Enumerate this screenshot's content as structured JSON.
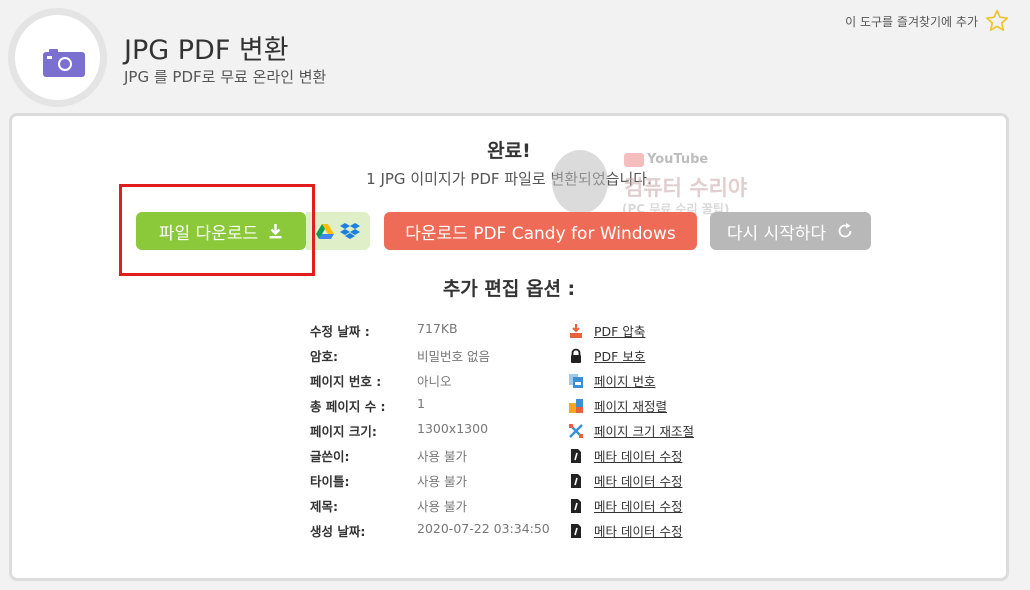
{
  "header": {
    "title": "JPG PDF 변환",
    "subtitle": "JPG 를 PDF로 무료 온라인 변환",
    "favorite_label": "이 도구를 즐겨찾기에 추가",
    "logo_icon": "camera-icon",
    "favorite_icon": "star-outline-icon"
  },
  "result": {
    "title": "완료!",
    "message": "1 JPG 이미지가 PDF 파일로 변환되었습니다."
  },
  "buttons": {
    "download_label": "파일 다운로드",
    "candy_label": "다운로드 PDF Candy for Windows",
    "restart_label": "다시 시작하다"
  },
  "watermark": {
    "badge": "YouTube",
    "main": "컴퓨터 수리야",
    "sub": "(PC 무료 수리 꿀팁)"
  },
  "options": {
    "title": "추가 편집 옵션 :",
    "rows": [
      {
        "key": "수정 날짜 :",
        "value": "717KB",
        "icon": "download-compress-icon",
        "link": "PDF 압축"
      },
      {
        "key": "암호:",
        "value": "비밀번호 없음",
        "icon": "lock-icon",
        "link": "PDF 보호"
      },
      {
        "key": "페이지 번호 :",
        "value": "아니오",
        "icon": "page-number-icon",
        "link": "페이지 번호"
      },
      {
        "key": "총 페이지 수 :",
        "value": "1",
        "icon": "reorder-icon",
        "link": "페이지 재정렬"
      },
      {
        "key": "페이지 크기:",
        "value": "1300x1300",
        "icon": "resize-icon",
        "link": "페이지 크기 재조절"
      },
      {
        "key": "글쓴이:",
        "value": "사용 불가",
        "icon": "file-edit-icon",
        "link": "메타 데이터 수정"
      },
      {
        "key": "타이틀:",
        "value": "사용 불가",
        "icon": "file-edit-icon",
        "link": "메타 데이터 수정"
      },
      {
        "key": "제목:",
        "value": "사용 불가",
        "icon": "file-edit-icon",
        "link": "메타 데이터 수정"
      },
      {
        "key": "생성 날짜:",
        "value": "2020-07-22 03:34:50",
        "icon": "file-edit-icon",
        "link": "메타 데이터 수정"
      }
    ]
  },
  "colors": {
    "download": "#8bc93a",
    "candy": "#ee6b57",
    "restart": "#b8b8b8",
    "highlight": "#e21d1d",
    "logo": "#7b6fd0"
  }
}
